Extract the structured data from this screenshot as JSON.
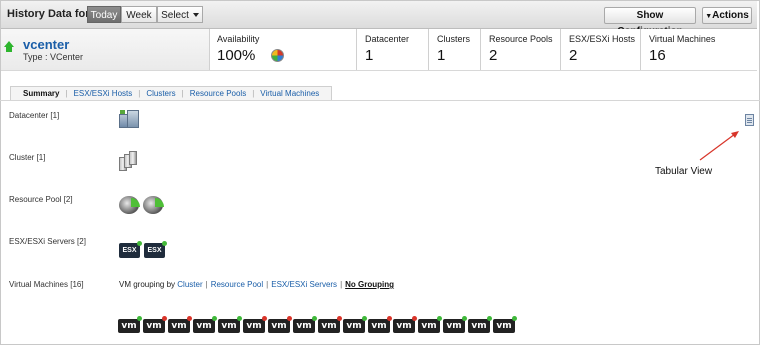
{
  "history": {
    "label": "History Data for :",
    "today": "Today",
    "week": "Week",
    "select": "Select",
    "show_config": "Show Configuration",
    "actions": "Actions"
  },
  "entity": {
    "name": "vcenter",
    "type": "Type : VCenter",
    "status_icon": "up-arrow-icon",
    "status_color": "#2db52d"
  },
  "metrics": [
    {
      "label": "Availability",
      "value": "100%"
    },
    {
      "label": "Datacenter",
      "value": "1"
    },
    {
      "label": "Clusters",
      "value": "1"
    },
    {
      "label": "Resource Pools",
      "value": "2"
    },
    {
      "label": "ESX/ESXi Hosts",
      "value": "2"
    },
    {
      "label": "Virtual Machines",
      "value": "16"
    }
  ],
  "tabs": [
    "Summary",
    "ESX/ESXi Hosts",
    "Clusters",
    "Resource Pools",
    "Virtual Machines"
  ],
  "rows": {
    "datacenter": "Datacenter [1]",
    "cluster": "Cluster [1]",
    "resource_pool": "Resource Pool [2]",
    "esx": "ESX/ESXi Servers [2]",
    "vms": "Virtual Machines [16]"
  },
  "esx_label": "ESX",
  "vm_label": "vm",
  "grouping": {
    "prefix": "VM grouping by",
    "options": [
      "Cluster",
      "Resource Pool",
      "ESX/ESXi Servers"
    ],
    "current": "No Grouping"
  },
  "vm_status": [
    "green",
    "red",
    "red",
    "green",
    "green",
    "red",
    "red",
    "green",
    "red",
    "green",
    "red",
    "red",
    "green",
    "green",
    "green",
    "green"
  ],
  "colors": {
    "green": "#3fb83a",
    "red": "#d8352a",
    "link": "#1a5ea8"
  },
  "callout": "Tabular View"
}
